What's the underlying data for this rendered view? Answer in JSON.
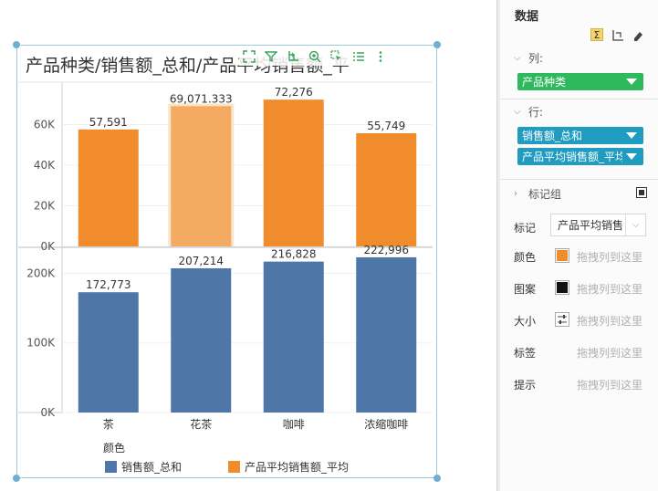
{
  "chart": {
    "title": "产品种类/销售额_总和/产品平均销售额_平均",
    "legend_title": "颜色",
    "colors": {
      "sales_sum": "#4e76a6",
      "avg_sales": "#f18c2d",
      "avg_highlight": "#f4ab61"
    }
  },
  "chart_data": {
    "type": "bar",
    "categories": [
      "茶",
      "花茶",
      "咖啡",
      "浓缩咖啡"
    ],
    "series": [
      {
        "name": "产品平均销售额_平均",
        "values": [
          57591,
          69071.333,
          72276,
          55749
        ],
        "labels": [
          "57,591",
          "69,071.333",
          "72,276",
          "55,749"
        ],
        "highlighted_index": 1
      },
      {
        "name": "销售额_总和",
        "values": [
          172773,
          207214,
          216828,
          222996
        ],
        "labels": [
          "172,773",
          "207,214",
          "216,828",
          "222,996"
        ]
      }
    ],
    "axes": {
      "top_y_ticks": [
        "0K",
        "20K",
        "40K",
        "60K"
      ],
      "top_y_tick_values": [
        0,
        20000,
        40000,
        60000
      ],
      "top_ylim": [
        0,
        80000
      ],
      "bottom_y_ticks": [
        "0K",
        "100K",
        "200K"
      ],
      "bottom_y_tick_values": [
        0,
        100000,
        200000
      ],
      "bottom_ylim": [
        0,
        236000
      ]
    },
    "grid": true,
    "legend_position": "bottom-left"
  },
  "toolbar": {
    "icons": [
      "fullscreen-icon",
      "filter-icon",
      "export-icon",
      "zoom-icon",
      "select-icon",
      "list-icon",
      "more-icon"
    ]
  },
  "panel": {
    "title": "数据",
    "columns_label": "列:",
    "rows_label": "行:",
    "columns_pill": "产品种类",
    "row_pills": [
      "销售额_总和",
      "产品平均销售额_平均"
    ],
    "mark_group_label": "标记组",
    "mark_label": "标记",
    "mark_select_value": "产品平均销售额_平均",
    "props": [
      {
        "label": "颜色",
        "placeholder": "拖拽列到这里"
      },
      {
        "label": "图案",
        "placeholder": "拖拽列到这里"
      },
      {
        "label": "大小",
        "placeholder": "拖拽列到这里"
      },
      {
        "label": "标签",
        "placeholder": "拖拽列到这里"
      },
      {
        "label": "提示",
        "placeholder": "拖拽列到这里"
      }
    ],
    "colors": {
      "columns_pill": "#2eb95d",
      "row_pill": "#1f9cc0"
    }
  }
}
